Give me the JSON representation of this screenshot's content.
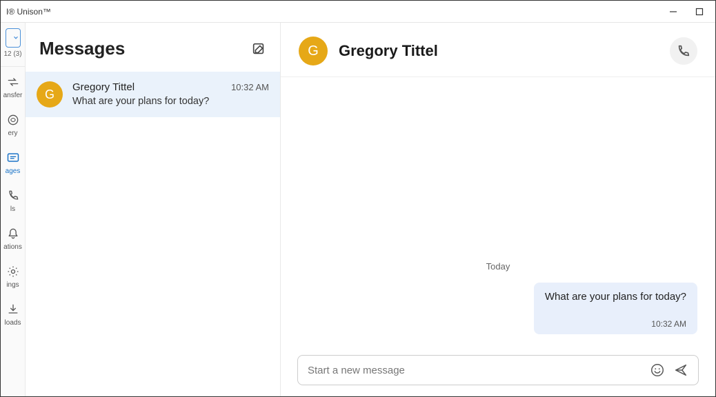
{
  "window": {
    "title": "I® Unison™"
  },
  "sidebar": {
    "battery_label": "12 (3)",
    "items": [
      {
        "label": "ansfer"
      },
      {
        "label": "ery"
      },
      {
        "label": "ages"
      },
      {
        "label": "ls"
      },
      {
        "label": "ations"
      },
      {
        "label": "ings"
      },
      {
        "label": "loads"
      }
    ]
  },
  "conversations": {
    "title": "Messages",
    "items": [
      {
        "initial": "G",
        "name": "Gregory Tittel",
        "time": "10:32 AM",
        "preview": "What are your plans for today?"
      }
    ]
  },
  "chat": {
    "contact_initial": "G",
    "contact_name": "Gregory Tittel",
    "date_separator": "Today",
    "messages": [
      {
        "text": "What are your plans for today?",
        "time": "10:32 AM"
      }
    ],
    "composer_placeholder": "Start a new message"
  },
  "colors": {
    "accent": "#1a73c7",
    "avatar_bg": "#e6a817",
    "bubble_bg": "#e8effb",
    "selected_bg": "#eaf2fb"
  }
}
